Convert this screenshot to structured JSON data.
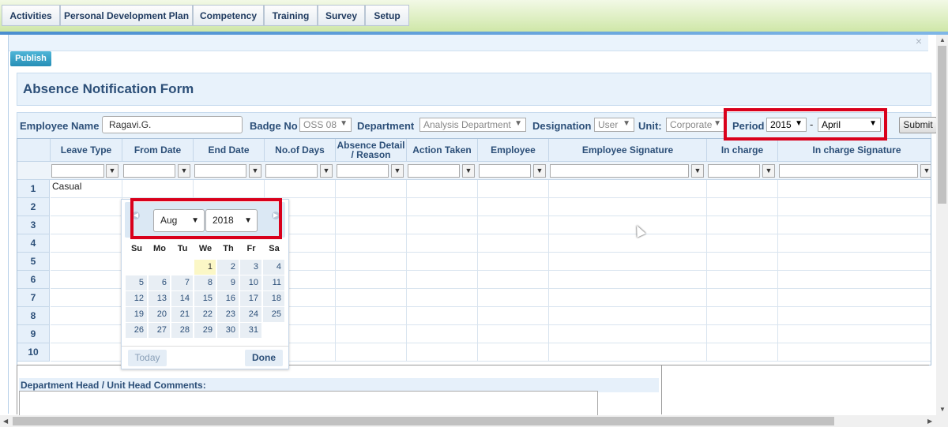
{
  "nav": {
    "items": [
      {
        "label": "Activities"
      },
      {
        "label": "Personal Development Plan"
      },
      {
        "label": "Competency"
      },
      {
        "label": "Training"
      },
      {
        "label": "Survey"
      },
      {
        "label": "Setup"
      }
    ]
  },
  "toolbar": {
    "publish_label": "Publish",
    "close_glyph": "×"
  },
  "form": {
    "title": "Absence Notification Form"
  },
  "filters": {
    "employee_name_label": "Employee Name",
    "employee_name_value": "Ragavi.G.",
    "badge_no_label": "Badge No",
    "badge_no_value": "OSS 08",
    "department_label": "Department",
    "department_value": "Analysis Department",
    "designation_label": "Designation",
    "designation_value": "User",
    "unit_label": "Unit:",
    "unit_value": "Corporate",
    "period_label": "Period",
    "period_year": "2015",
    "period_sep": "-",
    "period_month": "April",
    "submit_label": "Submit"
  },
  "grid": {
    "columns": [
      "Leave Type",
      "From Date",
      "End Date",
      "No.of Days",
      "Absence Detail / Reason",
      "Action Taken",
      "Employee",
      "Employee Signature",
      "In charge",
      "In charge Signature"
    ],
    "rows": [
      "1",
      "2",
      "3",
      "4",
      "5",
      "6",
      "7",
      "8",
      "9",
      "10"
    ],
    "row1_leave_type": "Casual"
  },
  "datepicker": {
    "month": "Aug",
    "year": "2018",
    "weekdays": [
      "Su",
      "Mo",
      "Tu",
      "We",
      "Th",
      "Fr",
      "Sa"
    ],
    "days": [
      "1",
      "2",
      "3",
      "4",
      "5",
      "6",
      "7",
      "8",
      "9",
      "10",
      "11",
      "12",
      "13",
      "14",
      "15",
      "16",
      "17",
      "18",
      "19",
      "20",
      "21",
      "22",
      "23",
      "24",
      "25",
      "26",
      "27",
      "28",
      "29",
      "30",
      "31"
    ],
    "highlighted_day": "1",
    "today_label": "Today",
    "done_label": "Done"
  },
  "comments": {
    "label": "Department Head / Unit Head Comments:"
  },
  "colors": {
    "accent": "#2c4f78",
    "highlight": "#d9001b",
    "publish": "#268eb6",
    "nav_bar": "#cfe7a8"
  }
}
